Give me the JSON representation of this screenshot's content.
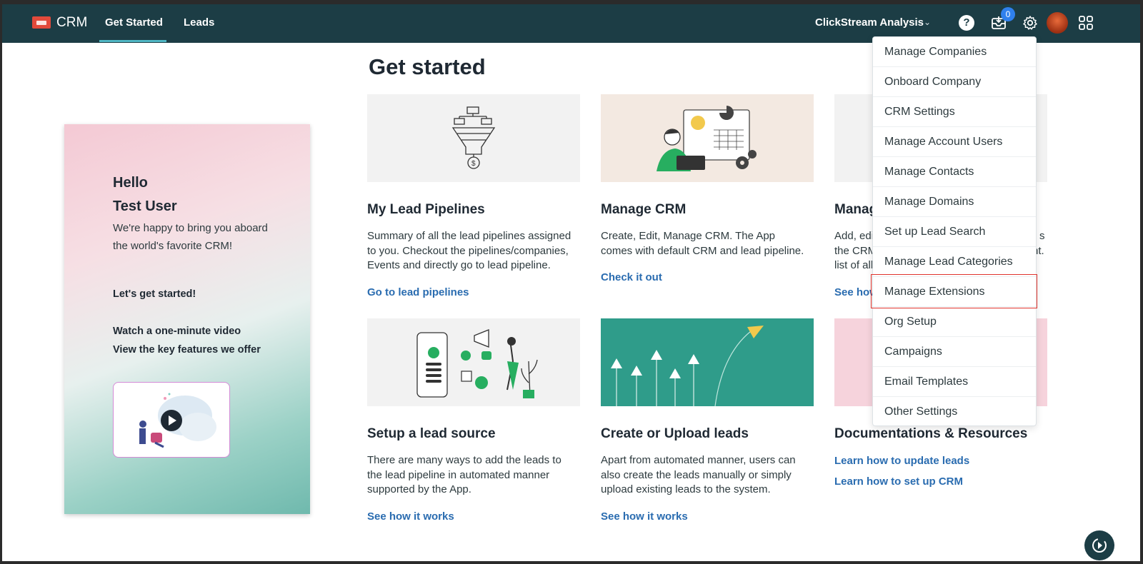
{
  "header": {
    "brand": "CRM",
    "tabs": [
      "Get Started",
      "Leads"
    ],
    "org_name": "ClickStream Analysis",
    "notification_count": "0",
    "help_label": "?"
  },
  "page": {
    "title": "Get started"
  },
  "welcome": {
    "hello": "Hello",
    "user": "Test User",
    "text": "We're happy to bring you aboard the world's favorite CRM!",
    "lets": "Let's get started!",
    "watch": "Watch a one-minute video",
    "view": "View the key features we offer"
  },
  "cards": [
    {
      "title": "My Lead Pipelines",
      "desc": "Summary of all the lead pipelines assigned to you. Checkout the pipelines/companies, Events and directly go to lead pipeline.",
      "link": "Go to lead pipelines"
    },
    {
      "title": "Manage CRM",
      "desc": "Create, Edit, Manage CRM. The App comes with default CRM and lead pipeline.",
      "link": "Check it out"
    },
    {
      "title": "Manag",
      "desc_lines": [
        "Add, edi",
        "the CRM",
        "list of all"
      ],
      "desc_tail": [
        "s",
        "",
        "nt."
      ],
      "link": "See how"
    },
    {
      "title": "Setup a lead source",
      "desc": "There are many ways to add the leads to the lead pipeline in automated manner supported by the App.",
      "link": "See how it works"
    },
    {
      "title": "Create or Upload leads",
      "desc": "Apart from automated manner, users can also create the leads manually or simply upload existing leads to the system.",
      "link": "See how it works"
    },
    {
      "title": "Documentations & Resources",
      "links": [
        "Learn how to update leads",
        "Learn how to set up CRM"
      ]
    }
  ],
  "dropdown": {
    "items": [
      "Manage Companies",
      "Onboard Company",
      "CRM Settings",
      "Manage Account Users",
      "Manage Contacts",
      "Manage Domains",
      "Set up Lead Search",
      "Manage Lead Categories",
      "Manage Extensions",
      "Org Setup",
      "Campaigns",
      "Email Templates",
      "Other Settings"
    ],
    "highlighted": "Manage Extensions"
  },
  "colors": {
    "topbar": "#1c3d45",
    "link": "#2a6cb0",
    "badge": "#2f80ed",
    "highlight_border": "#e0342d",
    "teal_card": "#2f9c8a"
  }
}
